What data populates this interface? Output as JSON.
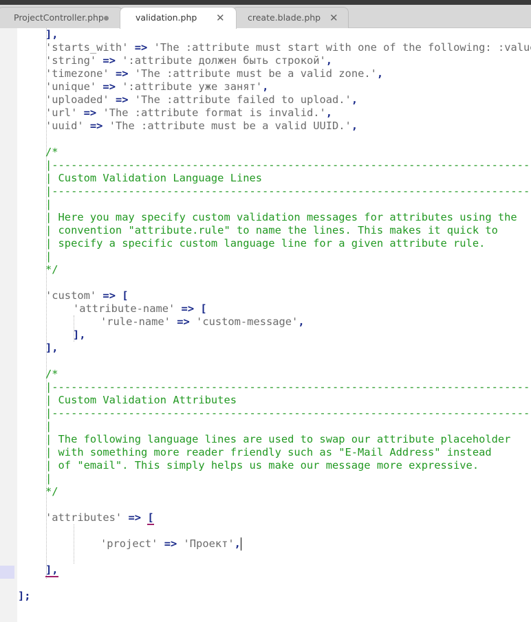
{
  "tabs": [
    {
      "label": "ProjectController.php",
      "state": "modified",
      "active": false
    },
    {
      "label": "validation.php",
      "state": "close",
      "active": true
    },
    {
      "label": "create.blade.php",
      "state": "close",
      "active": false
    }
  ],
  "editor": {
    "cursor_line": 40,
    "tokens": {
      "comma": ",",
      "close_bracket": "],",
      "close_bracket_semi": "];",
      "arrow": "=>",
      "open_bracket": "[",
      "comment_open": "/*",
      "comment_close": "*/",
      "comment_bar": "|",
      "comment_rule": "|-------------------------------------------------------------------------------------"
    },
    "rules": [
      {
        "key": "'starts_with'",
        "value": "'The :attribute must start with one of the following: :values.'"
      },
      {
        "key": "'string'",
        "value": "':attribute должен быть строкой'"
      },
      {
        "key": "'timezone'",
        "value": "'The :attribute must be a valid zone.'"
      },
      {
        "key": "'unique'",
        "value": "':attribute уже занят'"
      },
      {
        "key": "'uploaded'",
        "value": "'The :attribute failed to upload.'"
      },
      {
        "key": "'url'",
        "value": "'The :attribute format is invalid.'"
      },
      {
        "key": "'uuid'",
        "value": "'The :attribute must be a valid UUID.'"
      }
    ],
    "block1": {
      "title": "| Custom Validation Language Lines",
      "text": [
        "| Here you may specify custom validation messages for attributes using the",
        "| convention \"attribute.rule\" to name the lines. This makes it quick to",
        "| specify a specific custom language line for a given attribute rule."
      ]
    },
    "custom": {
      "key": "'custom'",
      "attr_key": "'attribute-name'",
      "rule_key": "'rule-name'",
      "rule_value": "'custom-message'"
    },
    "block2": {
      "title": "| Custom Validation Attributes",
      "text": [
        "| The following language lines are used to swap our attribute placeholder",
        "| with something more reader friendly such as \"E-Mail Address\" instead",
        "| of \"email\". This simply helps us make our message more expressive."
      ]
    },
    "attributes": {
      "key": "'attributes'",
      "project_key": "'project'",
      "project_value": "'Проект'"
    }
  }
}
